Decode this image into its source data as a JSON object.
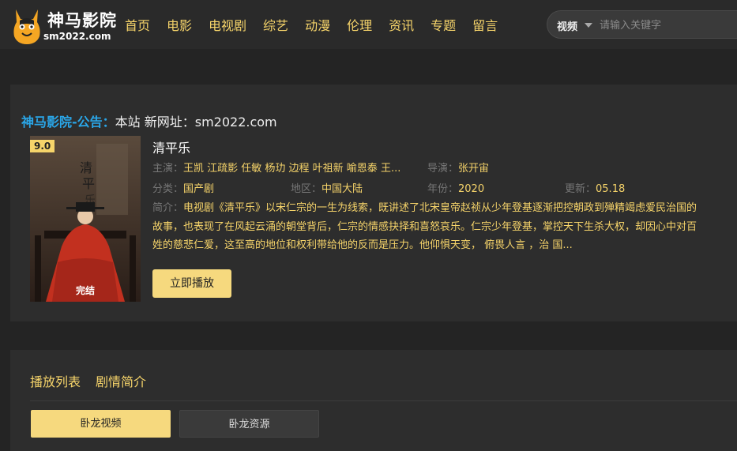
{
  "site": {
    "name": "神马影院",
    "domain": "sm2022.com"
  },
  "nav": [
    {
      "label": "首页"
    },
    {
      "label": "电影"
    },
    {
      "label": "电视剧"
    },
    {
      "label": "综艺"
    },
    {
      "label": "动漫"
    },
    {
      "label": "伦理"
    },
    {
      "label": "资讯"
    },
    {
      "label": "专题"
    },
    {
      "label": "留言"
    }
  ],
  "search": {
    "type": "视频",
    "placeholder": "请输入关键字"
  },
  "notice": {
    "label": "神马影院-公告：",
    "text": "本站 新网址：sm2022.com"
  },
  "movie": {
    "score": "9.0",
    "status": "完结",
    "title": "清平乐",
    "cast_label": "主演：",
    "cast": "王凯 江疏影 任敏 杨玏 边程 叶祖新 喻恩泰 王...",
    "director_label": "导演：",
    "director": "张开宙",
    "genre_label": "分类：",
    "genre": "国产剧",
    "region_label": "地区：",
    "region": "中国大陆",
    "year_label": "年份：",
    "year": "2020",
    "update_label": "更新：",
    "update": "05.18",
    "synopsis_label": "简介：",
    "synopsis": "电视剧《清平乐》以宋仁宗的一生为线索，既讲述了北宋皇帝赵祯从少年登基逐渐把控朝政到殚精竭虑爱民治国的故事，也表现了在风起云涌的朝堂背后，仁宗的情感抉择和喜怒哀乐。仁宗少年登基，掌控天下生杀大权，却因心中对百姓的慈悲仁爱，这至高的地位和权利带给他的反而是压力。他仰惧天变， 俯畏人言 ，治 国...",
    "play_label": "立即播放"
  },
  "playlist": {
    "tabs": [
      {
        "label": "播放列表"
      },
      {
        "label": "剧情简介"
      }
    ],
    "sources": [
      {
        "label": "卧龙视频"
      },
      {
        "label": "卧龙资源"
      }
    ]
  },
  "colors": {
    "accent": "#f6d46a",
    "notice": "#2aa6e8",
    "background": "#242424",
    "panel": "#2d2d2d"
  }
}
